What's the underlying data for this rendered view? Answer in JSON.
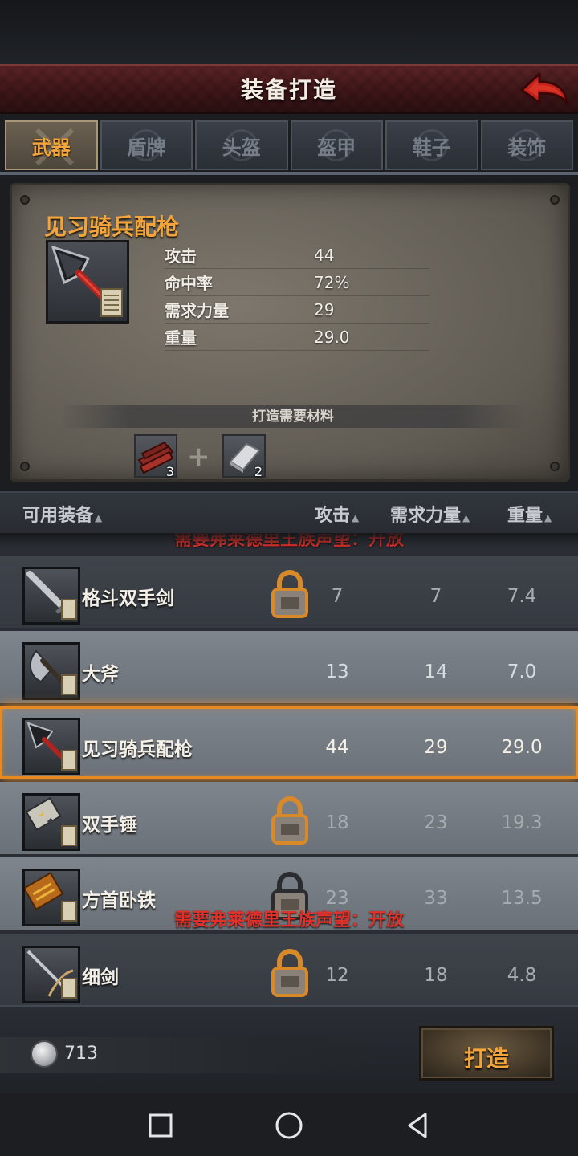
{
  "header": {
    "title": "装备打造"
  },
  "tabs": [
    {
      "label": "武器",
      "active": true
    },
    {
      "label": "盾牌",
      "active": false
    },
    {
      "label": "头盔",
      "active": false
    },
    {
      "label": "盔甲",
      "active": false
    },
    {
      "label": "鞋子",
      "active": false
    },
    {
      "label": "装饰",
      "active": false
    }
  ],
  "detail": {
    "name": "见习骑兵配枪",
    "icon": "spear-icon",
    "stats": [
      {
        "label": "攻击",
        "value": "44"
      },
      {
        "label": "命中率",
        "value": "72%"
      },
      {
        "label": "需求力量",
        "value": "29"
      },
      {
        "label": "重量",
        "value": "29.0"
      }
    ],
    "materials_title": "打造需要材料",
    "materials": [
      {
        "icon": "wood-planks-icon",
        "count": "3"
      },
      {
        "icon": "iron-ingot-icon",
        "count": "2"
      }
    ]
  },
  "list_header": {
    "name": "可用装备",
    "attack": "攻击",
    "strength": "需求力量",
    "weight": "重量"
  },
  "unlock_notice": "需要弗莱德里王族声望：开放",
  "items": [
    {
      "name": "格斗双手剑",
      "icon": "greatsword-icon",
      "attack": "7",
      "strength": "7",
      "weight": "7.4",
      "locked": true
    },
    {
      "name": "大斧",
      "icon": "great-axe-icon",
      "attack": "13",
      "strength": "14",
      "weight": "7.0",
      "locked": false
    },
    {
      "name": "见习骑兵配枪",
      "icon": "spear-icon",
      "attack": "44",
      "strength": "29",
      "weight": "29.0",
      "locked": false,
      "selected": true
    },
    {
      "name": "双手锤",
      "icon": "two-handed-hammer-icon",
      "attack": "18",
      "strength": "23",
      "weight": "19.3",
      "locked": true
    },
    {
      "name": "方首卧铁",
      "icon": "square-hammer-icon",
      "attack": "23",
      "strength": "33",
      "weight": "13.5",
      "locked": true
    },
    {
      "name": "细剑",
      "icon": "rapier-icon",
      "attack": "12",
      "strength": "18",
      "weight": "4.8",
      "locked": true
    }
  ],
  "footer": {
    "currency_icon": "silver-coin-icon",
    "currency_amount": "713",
    "forge_label": "打造"
  },
  "colors": {
    "accent_orange": "#f3a53b",
    "header_red": "#4a1a1c",
    "lock_red_text": "#e2312a",
    "selection_glow": "#e88a22"
  }
}
